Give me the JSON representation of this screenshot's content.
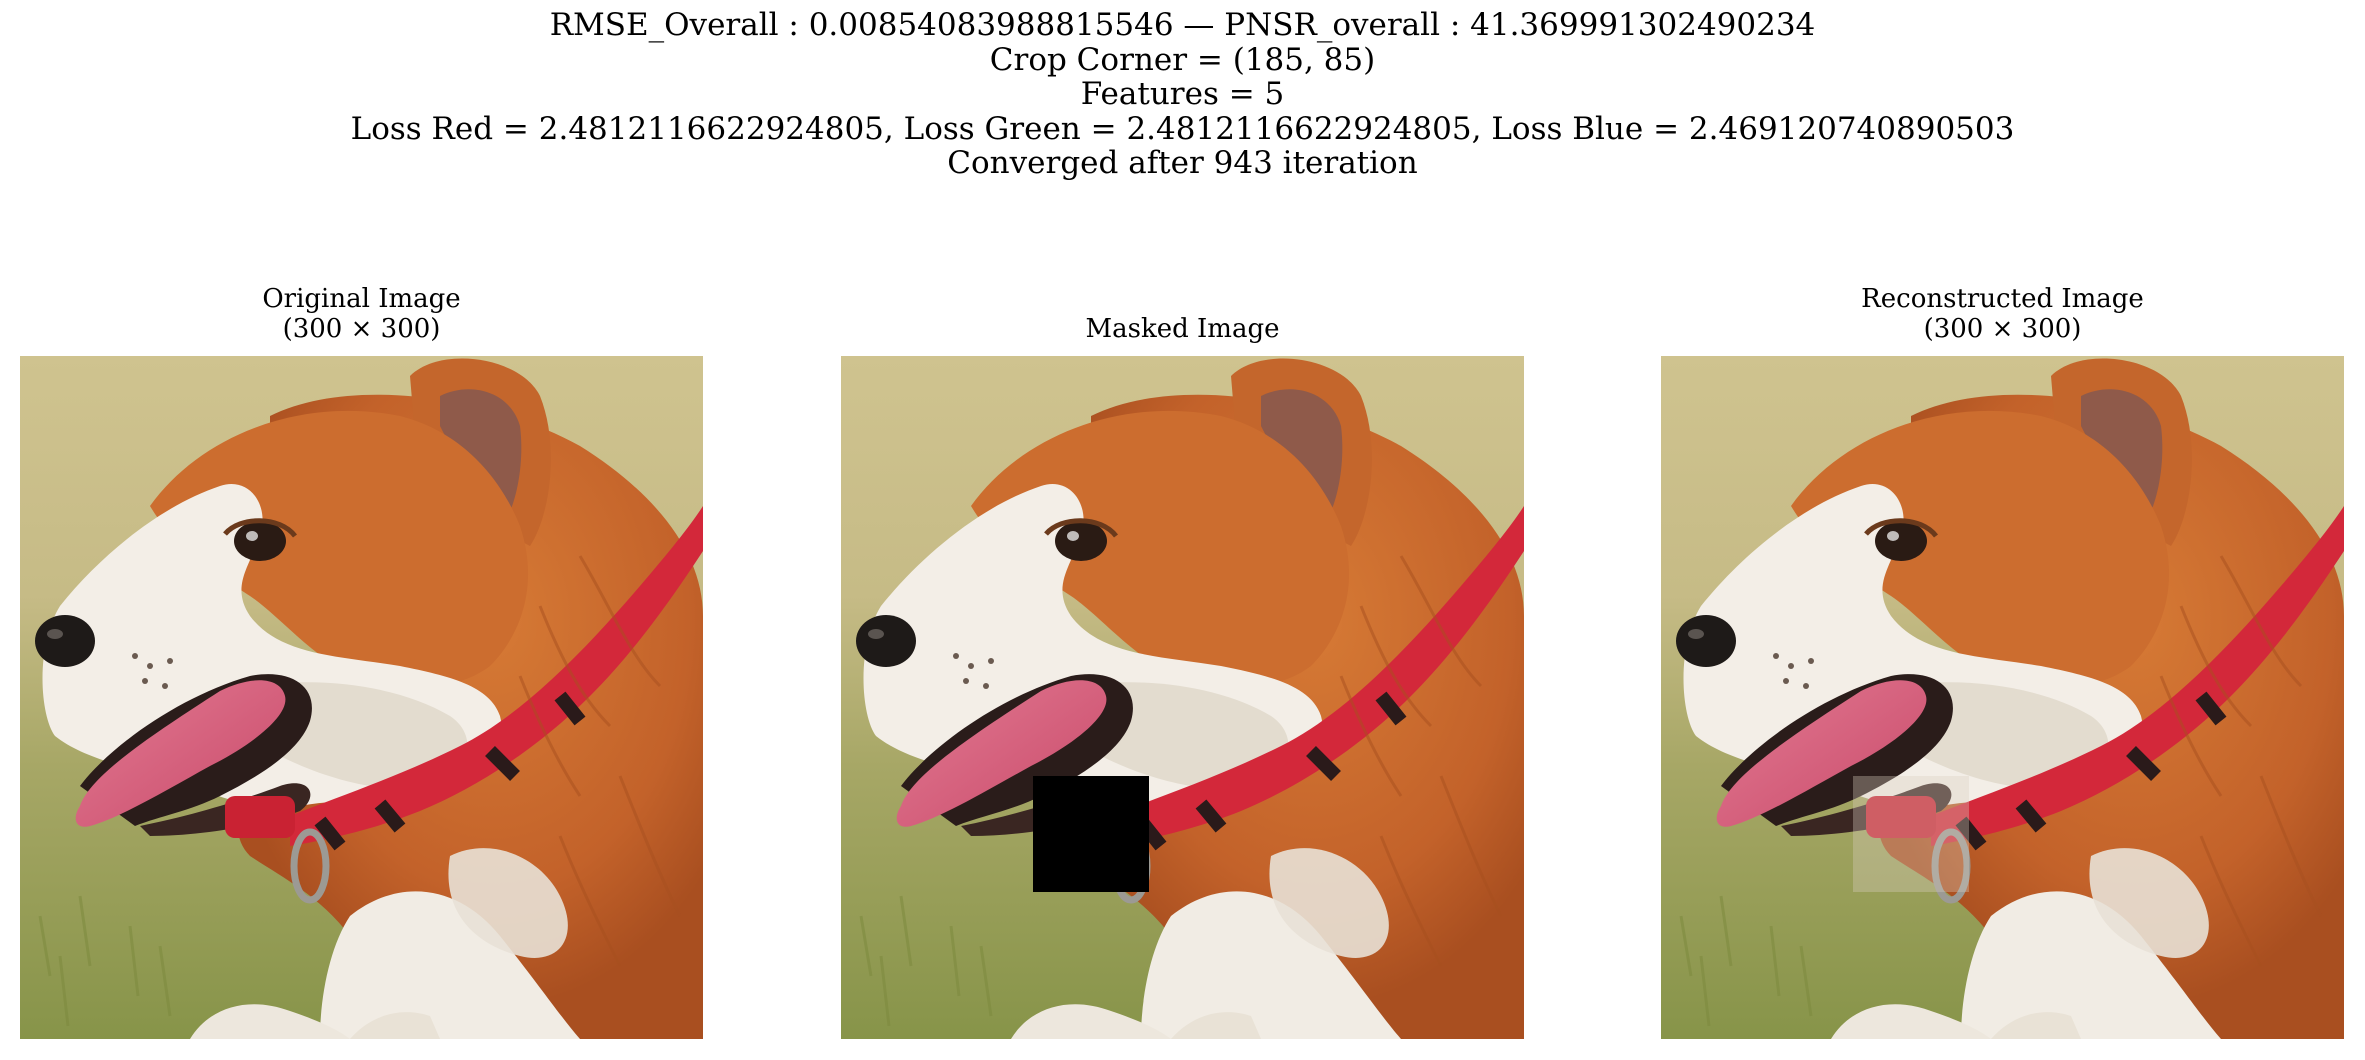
{
  "figure": {
    "suptitle_lines": [
      "RMSE_Overall : 0.00854083988815546 — PNSR_overall : 41.369991302490234",
      "Crop Corner = (185, 85)",
      "Features = 5",
      "Loss Red = 2.4812116622924805, Loss Green = 2.4812116622924805, Loss Blue = 2.469120740890503",
      "Converged after 943 iteration"
    ]
  },
  "panels": {
    "original": {
      "title_line1": "Original Image",
      "title_line2": "(300 × 300)",
      "image": "corgi-photo"
    },
    "masked": {
      "title_line1": "Masked Image",
      "image": "corgi-photo-with-black-mask"
    },
    "reconstructed": {
      "title_line1": "Reconstructed Image",
      "title_line2": "(300 × 300)",
      "image": "corgi-photo-reconstructed"
    }
  },
  "colors": {
    "fur_orange": "#c8662a",
    "fur_white": "#f2ede6",
    "collar_red": "#d22838",
    "tongue_pink": "#d9607a",
    "grass_green": "#8f9a52",
    "background_tan": "#c9bc8a",
    "mask_black": "#000000"
  }
}
